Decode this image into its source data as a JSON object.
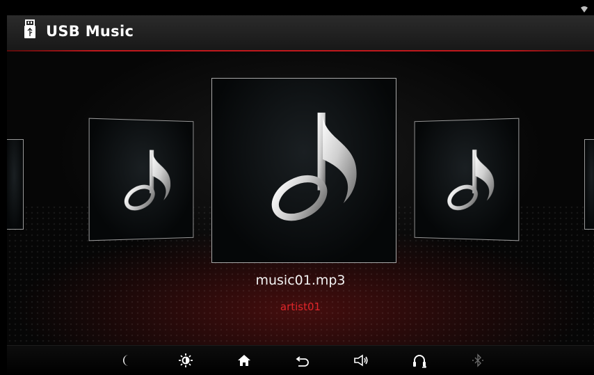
{
  "header": {
    "title": "USB Music",
    "icon": "usb-icon"
  },
  "status_bar": {
    "icon": "wifi-icon"
  },
  "carousel": {
    "icon": "music-note-icon",
    "current": {
      "track_name": "music01.mp3",
      "artist": "artist01"
    }
  },
  "bottom_bar": {
    "buttons": [
      {
        "name": "night-mode",
        "icon": "moon-icon"
      },
      {
        "name": "brightness",
        "icon": "sun-icon"
      },
      {
        "name": "home",
        "icon": "home-icon"
      },
      {
        "name": "back",
        "icon": "back-arrow-icon"
      },
      {
        "name": "volume",
        "icon": "speaker-icon"
      },
      {
        "name": "headset",
        "icon": "headphone-icon"
      },
      {
        "name": "bluetooth",
        "icon": "bluetooth-icon",
        "state": "disabled"
      }
    ]
  },
  "colors": {
    "accent": "#c0181c",
    "artist_text": "#e0262a",
    "background": "#000000"
  }
}
